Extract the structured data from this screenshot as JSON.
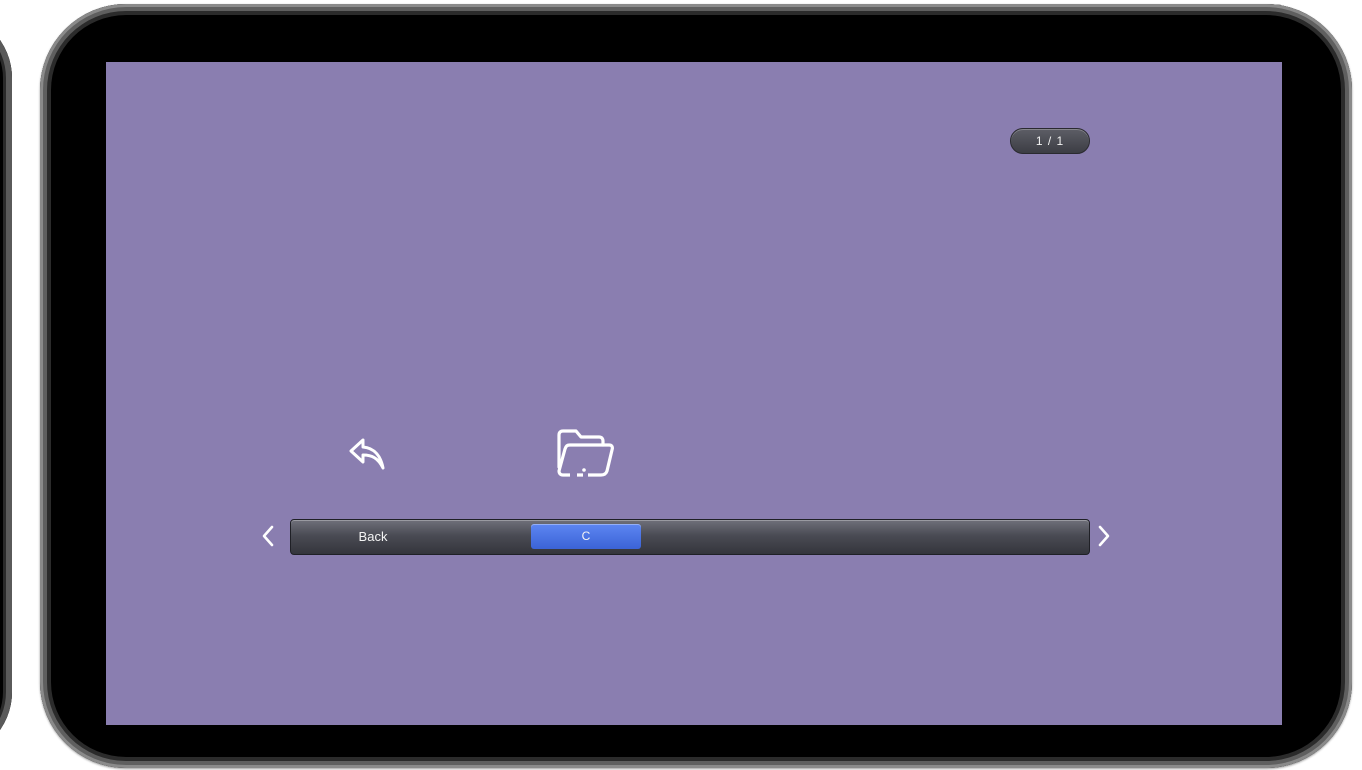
{
  "screen": {
    "background_color": "#8a7eb0"
  },
  "page_indicator": {
    "text": "1 / 1"
  },
  "icons": [
    {
      "name": "back-arrow-icon",
      "label": "Back"
    },
    {
      "name": "folder-icon",
      "label": "C"
    }
  ],
  "label_bar": {
    "items": [
      {
        "label": "Back",
        "selected": false
      },
      {
        "label": "C",
        "selected": true
      }
    ],
    "selected_color": "#3f68dc"
  },
  "navigation": {
    "prev_icon": "chevron-left-icon",
    "next_icon": "chevron-right-icon"
  }
}
